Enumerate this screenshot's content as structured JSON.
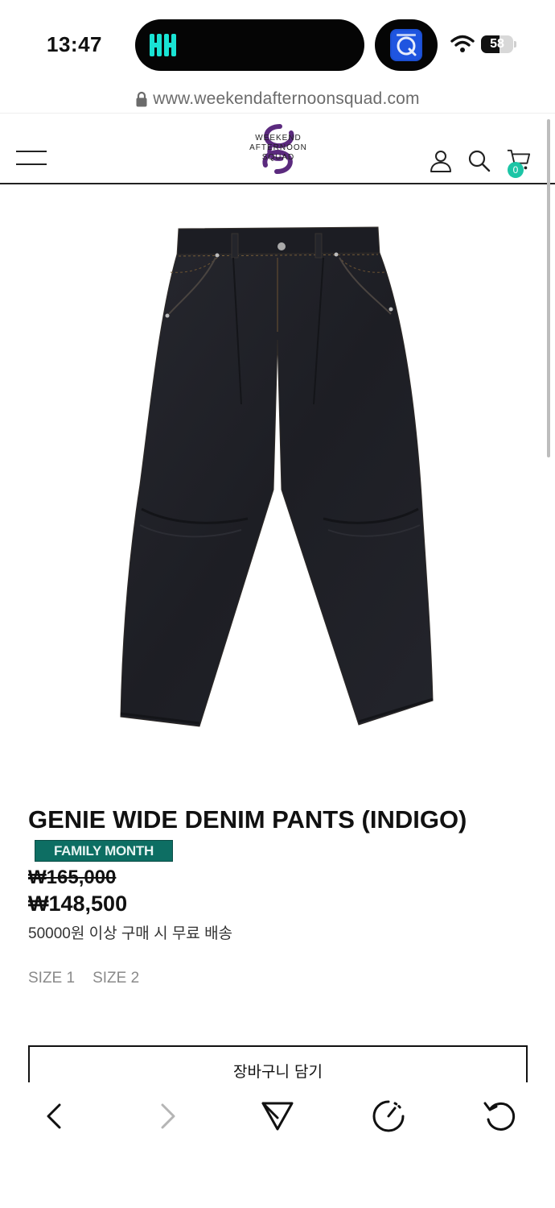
{
  "status_bar": {
    "time": "13:47",
    "battery_level": "58",
    "battery_fraction": 0.58,
    "left_island_app": "app-logo-icon",
    "right_island_app": "app-icon"
  },
  "browser": {
    "url": "www.weekendafternoonsquad.com"
  },
  "header": {
    "logo_line1": "WEEKEND",
    "logo_line2": "AFTERNOON",
    "logo_line3": "SQUAD",
    "cart_count": "0",
    "accent_color": "#1cc5a6",
    "logo_color": "#5b2a7e"
  },
  "product": {
    "title": "GENIE WIDE DENIM PANTS (INDIGO)",
    "badge": "FAMILY MONTH",
    "badge_color": "#0d6e63",
    "original_price": "₩165,000",
    "sale_price": "₩148,500",
    "shipping_note": "50000원 이상 구매 시 무료 배송",
    "sizes": [
      "SIZE 1",
      "SIZE 2"
    ],
    "add_to_cart_label": "장바구니 담기",
    "image_alt_icon": "denim-pants-image"
  },
  "toolbar": {
    "back_icon": "chevron-left-icon",
    "forward_icon": "chevron-right-icon",
    "share_icon": "send-icon",
    "speed_icon": "speedometer-icon",
    "reload_icon": "reload-icon"
  }
}
